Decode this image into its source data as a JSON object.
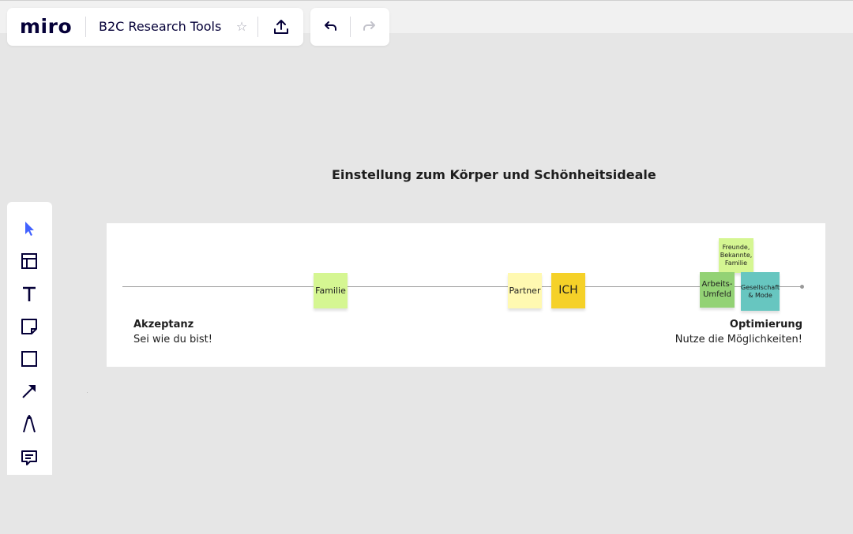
{
  "header": {
    "logo": "miro",
    "board_title": "B2C Research Tools",
    "star_icon": "star-icon",
    "share_icon": "upload-icon",
    "undo_icon": "undo-icon",
    "redo_icon": "redo-icon"
  },
  "toolbar": {
    "tools": [
      "select-cursor-icon",
      "template-icon",
      "text-icon",
      "sticky-note-icon",
      "shape-icon",
      "arrow-icon",
      "pen-icon",
      "comment-icon"
    ],
    "active_color": "#4262ff"
  },
  "board": {
    "heading": "Einstellung zum Körper und Schönheitsideale",
    "left_title": "Akzeptanz",
    "left_sub": "Sei wie du bist!",
    "right_title": "Optimierung",
    "right_sub": "Nutze die Möglichkeiten!",
    "stickies": {
      "familie": {
        "text": "Familie",
        "color": "#d5f692"
      },
      "partner": {
        "text": "Partner",
        "color": "#fff9b1"
      },
      "ich": {
        "text": "ICH",
        "color": "#f5d128"
      },
      "freunde": {
        "text": "Freunde, Bekannte, Familie",
        "color": "#d5f692"
      },
      "arbeit": {
        "text": "Arbeits-Umfeld",
        "color": "#93d275"
      },
      "gesellschaft": {
        "text": "Gesellschaft & Mode",
        "color": "#67c6c0"
      }
    }
  }
}
